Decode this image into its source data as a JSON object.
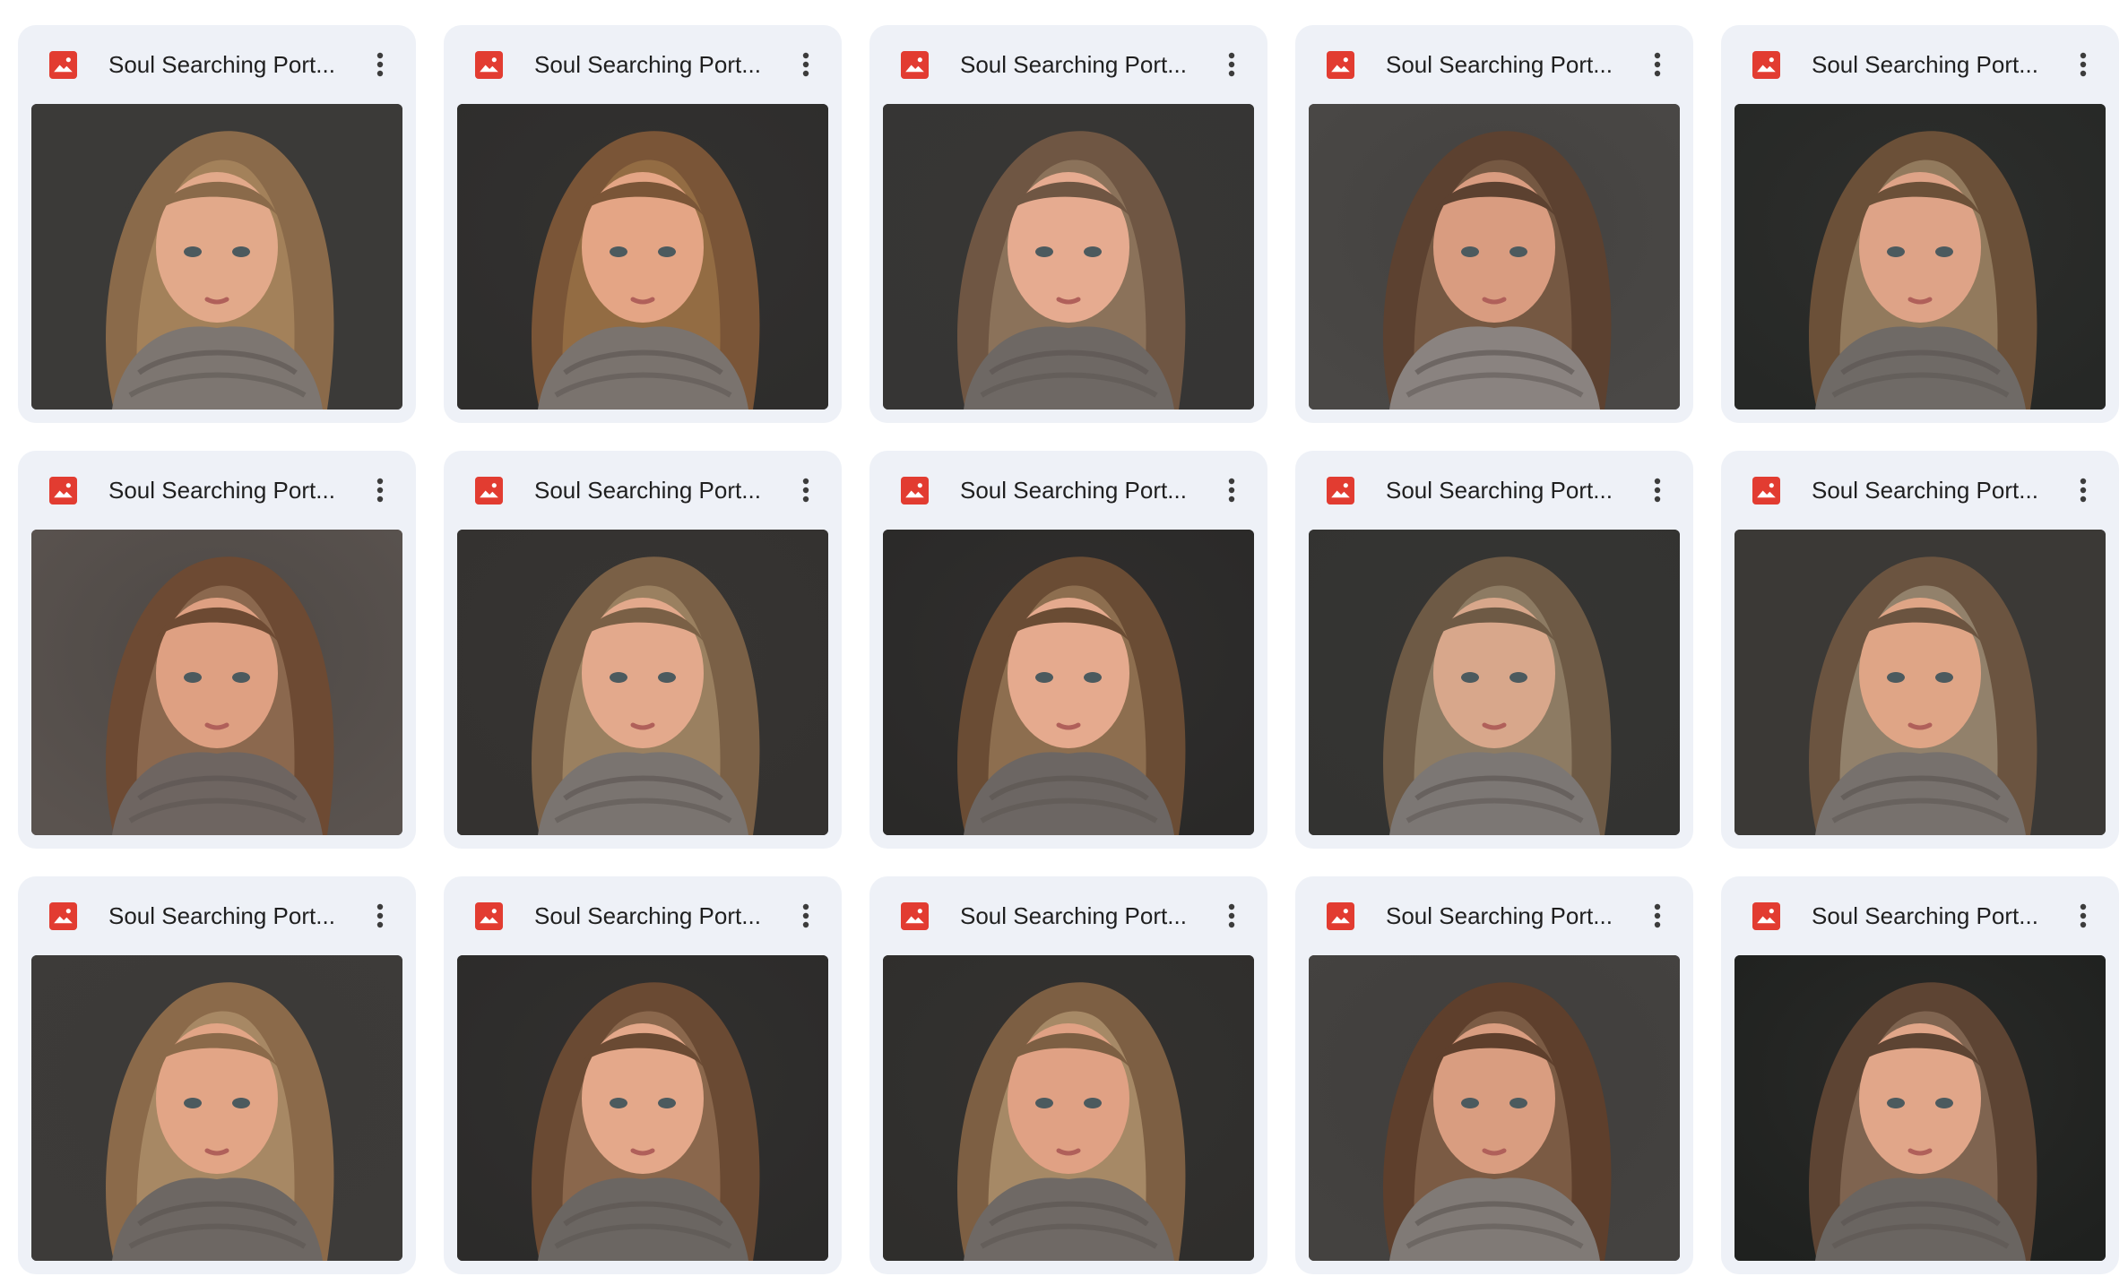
{
  "files": [
    {
      "title": "Soul Searching Port...",
      "icon": "image-file-icon",
      "menu_icon": "more-vert-icon",
      "thumbnail": {
        "bg": "#3b3a38",
        "hair": "#8a6a4a",
        "hair_light": "#b89468",
        "scarf": "#7d7671",
        "skin": "#e2a98a"
      }
    },
    {
      "title": "Soul Searching Port...",
      "icon": "image-file-icon",
      "menu_icon": "more-vert-icon",
      "thumbnail": {
        "bg": "#2e2d2c",
        "hair": "#7a5537",
        "hair_light": "#a8804f",
        "scarf": "#7a736e",
        "skin": "#e4a585"
      }
    },
    {
      "title": "Soul Searching Port...",
      "icon": "image-file-icon",
      "menu_icon": "more-vert-icon",
      "thumbnail": {
        "bg": "#363534",
        "hair": "#6f5643",
        "hair_light": "#a38b6e",
        "scarf": "#6e6864",
        "skin": "#e6ab90"
      }
    },
    {
      "title": "Soul Searching Port...",
      "icon": "image-file-icon",
      "menu_icon": "more-vert-icon",
      "thumbnail": {
        "bg": "#4a4846",
        "hair": "#5c4130",
        "hair_light": "#8b6b52",
        "scarf": "#8a8380",
        "skin": "#d99c80"
      }
    },
    {
      "title": "Soul Searching Port...",
      "icon": "image-file-icon",
      "menu_icon": "more-vert-icon",
      "thumbnail": {
        "bg": "#262826",
        "hair": "#6b5038",
        "hair_light": "#b29c7c",
        "scarf": "#6f6a66",
        "skin": "#dea387"
      }
    },
    {
      "title": "Soul Searching Port...",
      "icon": "image-file-icon",
      "menu_icon": "more-vert-icon",
      "thumbnail": {
        "bg": "#5a534f",
        "hair": "#6d4a33",
        "hair_light": "#a48264",
        "scarf": "#6e6561",
        "skin": "#dea082"
      }
    },
    {
      "title": "Soul Searching Port...",
      "icon": "image-file-icon",
      "menu_icon": "more-vert-icon",
      "thumbnail": {
        "bg": "#343230",
        "hair": "#7a6046",
        "hair_light": "#b49a76",
        "scarf": "#7a7470",
        "skin": "#e3a98c"
      }
    },
    {
      "title": "Soul Searching Port...",
      "icon": "image-file-icon",
      "menu_icon": "more-vert-icon",
      "thumbnail": {
        "bg": "#2a2928",
        "hair": "#6a4c34",
        "hair_light": "#a98a66",
        "scarf": "#6c6663",
        "skin": "#e5aa8e"
      }
    },
    {
      "title": "Soul Searching Port...",
      "icon": "image-file-icon",
      "menu_icon": "more-vert-icon",
      "thumbnail": {
        "bg": "#333331",
        "hair": "#6e5a45",
        "hair_light": "#a8977c",
        "scarf": "#7c7774",
        "skin": "#d8a78b"
      }
    },
    {
      "title": "Soul Searching Port...",
      "icon": "image-file-icon",
      "menu_icon": "more-vert-icon",
      "thumbnail": {
        "bg": "#3b3936",
        "hair": "#6b5440",
        "hair_light": "#b3a58e",
        "scarf": "#77716d",
        "skin": "#dfa586"
      }
    },
    {
      "title": "Soul Searching Port...",
      "icon": "image-file-icon",
      "menu_icon": "more-vert-icon",
      "thumbnail": {
        "bg": "#3d3b39",
        "hair": "#8b6a4a",
        "hair_light": "#c0a07a",
        "scarf": "#6d6763",
        "skin": "#e2a586"
      }
    },
    {
      "title": "Soul Searching Port...",
      "icon": "image-file-icon",
      "menu_icon": "more-vert-icon",
      "thumbnail": {
        "bg": "#2c2b2a",
        "hair": "#6a4a33",
        "hair_light": "#a48060",
        "scarf": "#6b6662",
        "skin": "#e4a88a"
      }
    },
    {
      "title": "Soul Searching Port...",
      "icon": "image-file-icon",
      "menu_icon": "more-vert-icon",
      "thumbnail": {
        "bg": "#2f2e2c",
        "hair": "#7d5f43",
        "hair_light": "#c9ab84",
        "scarf": "#6f6965",
        "skin": "#e0a184"
      }
    },
    {
      "title": "Soul Searching Port...",
      "icon": "image-file-icon",
      "menu_icon": "more-vert-icon",
      "thumbnail": {
        "bg": "#444240",
        "hair": "#5e3f2c",
        "hair_light": "#94735a",
        "scarf": "#807a76",
        "skin": "#d99d80"
      }
    },
    {
      "title": "Soul Searching Port...",
      "icon": "image-file-icon",
      "menu_icon": "more-vert-icon",
      "thumbnail": {
        "bg": "#1f211f",
        "hair": "#5d4433",
        "hair_light": "#9a8068",
        "scarf": "#6a6561",
        "skin": "#e1a689"
      }
    }
  ]
}
